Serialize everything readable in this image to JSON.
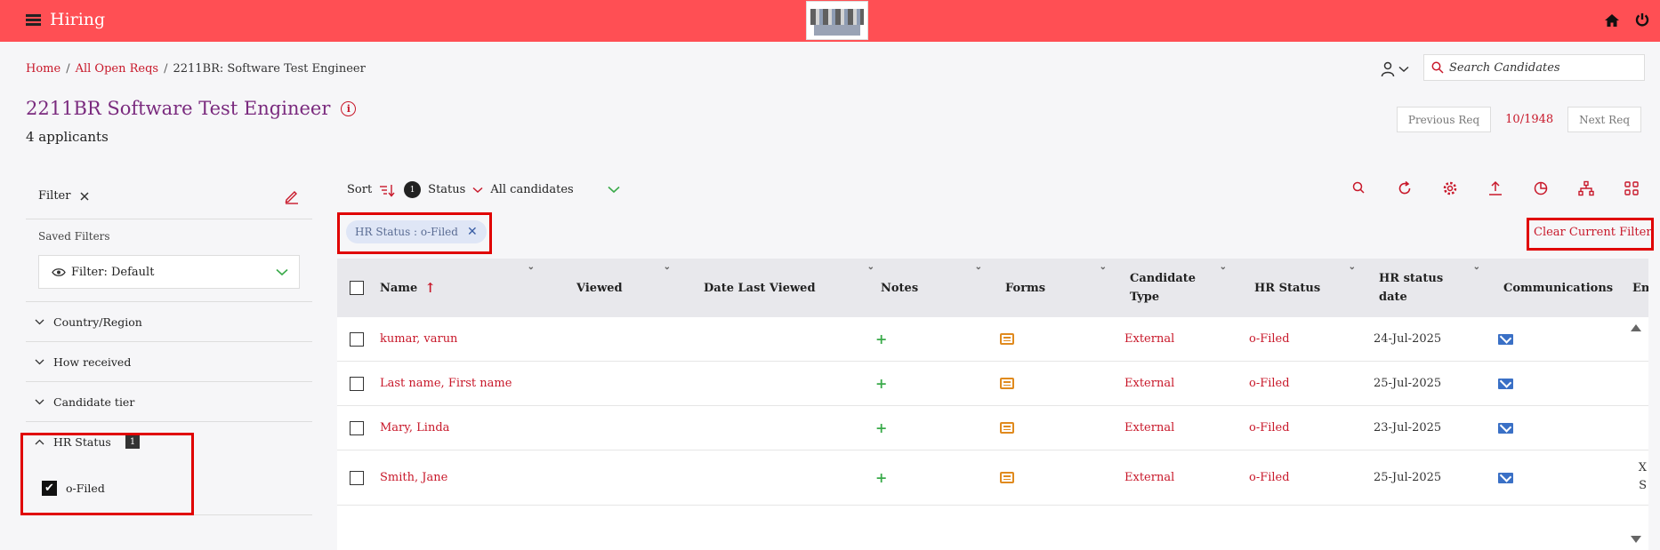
{
  "app": {
    "title": "Hiring"
  },
  "breadcrumb": {
    "home": "Home",
    "sep": "/",
    "open_reqs": "All Open Reqs",
    "current": "2211BR: Software Test Engineer"
  },
  "page": {
    "title": "2211BR Software Test Engineer",
    "applicants": "4 applicants"
  },
  "search": {
    "placeholder": "Search Candidates"
  },
  "req_nav": {
    "previous": "Previous Req",
    "count": "10/1948",
    "next": "Next Req"
  },
  "sidebar": {
    "filter_label": "Filter",
    "saved_filters_label": "Saved Filters",
    "selected_filter": "Filter: Default",
    "facets": [
      "Country/Region",
      "How received",
      "Candidate tier"
    ],
    "hr_status": {
      "label": "HR Status",
      "count": "1",
      "option": "o-Filed"
    }
  },
  "toolbar": {
    "sort": "Sort",
    "status_badge": "1",
    "status": "Status",
    "candidates": "All candidates"
  },
  "active_filter": {
    "label": "HR Status : o-Filed"
  },
  "clear_filter": "Clear Current Filter",
  "grid": {
    "columns": {
      "name": "Name",
      "viewed": "Viewed",
      "date_last_viewed": "Date Last Viewed",
      "notes": "Notes",
      "forms": "Forms",
      "candidate_type": "Candidate Type",
      "hr_status": "HR Status",
      "hr_status_date": "HR status date",
      "communications": "Communications",
      "extra": "Emp"
    },
    "rows": [
      {
        "name": "kumar, varun",
        "candidate_type": "External",
        "hr_status": "o-Filed",
        "date": "24-Jul-2025"
      },
      {
        "name": "Last name, First name",
        "candidate_type": "External",
        "hr_status": "o-Filed",
        "date": "25-Jul-2025"
      },
      {
        "name": "Mary, Linda",
        "candidate_type": "External",
        "hr_status": "o-Filed",
        "date": "23-Jul-2025"
      },
      {
        "name": "Smith, Jane",
        "candidate_type": "External",
        "hr_status": "o-Filed",
        "date": "25-Jul-2025"
      }
    ],
    "cut_off_text": {
      "line1": "X",
      "line2": "S"
    }
  },
  "colors": {
    "topbar": "#ff4f54",
    "accent": "#c8182a",
    "title": "#7a2a7e",
    "highlight": "#e00000"
  }
}
